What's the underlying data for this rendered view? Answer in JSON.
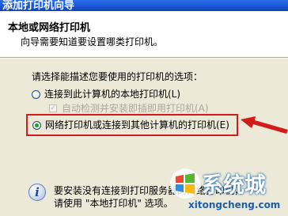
{
  "window": {
    "title": "添加打印机向导"
  },
  "header": {
    "title": "本地或网络打印机",
    "subtitle": "向导需要知道要设置哪类打印机。"
  },
  "main": {
    "prompt": "请选择能描述您要使用的打印机的选项：",
    "options": [
      {
        "label": "连接到此计算机的本地打印机(L)",
        "selected": false
      },
      {
        "label": "网络打印机或连接到其他计算机的打印机(E)",
        "selected": true
      }
    ],
    "autodetect": {
      "label": "自动检测并安装即插即用打印机(A)",
      "checked": true,
      "enabled": false
    },
    "info": {
      "line1": "要安装没有连接到打印服务器的网络打印机，",
      "line2": "请使用 \"本地打印机\" 选项。"
    }
  },
  "annotation": {
    "highlight_color": "#d41b1b"
  },
  "watermark": {
    "text": "系统城",
    "url": "xitongcheng.com"
  }
}
